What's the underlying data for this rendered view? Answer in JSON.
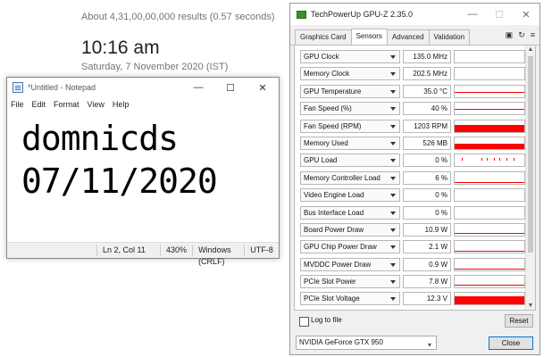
{
  "google": {
    "results": "About 4,31,00,00,000 results (0.57 seconds)",
    "time": "10:16 am",
    "date": "Saturday, 7 November 2020 (IST)"
  },
  "notepad": {
    "title": "*Untitled - Notepad",
    "menu": [
      "File",
      "Edit",
      "Format",
      "View",
      "Help"
    ],
    "lines": [
      "domnicds",
      "07/11/2020"
    ],
    "status": {
      "position": "Ln 2, Col 11",
      "zoom": "430%",
      "eol": "Windows (CRLF)",
      "encoding": "UTF-8"
    },
    "controls": {
      "minimize": "—",
      "maximize": "☐",
      "close": "✕"
    }
  },
  "gpuz": {
    "title": "TechPowerUp GPU-Z 2.35.0",
    "controls": {
      "minimize": "—",
      "maximize": "☐",
      "close": "✕"
    },
    "tabs": [
      "Graphics Card",
      "Sensors",
      "Advanced",
      "Validation"
    ],
    "active_tab": "Sensors",
    "tools": {
      "camera": "▣",
      "refresh": "↻",
      "menu": "≡"
    },
    "sensors": [
      {
        "label": "GPU Clock",
        "value": "135.0 MHz",
        "graph": "none",
        "level": 0
      },
      {
        "label": "Memory Clock",
        "value": "202.5 MHz",
        "graph": "none",
        "level": 0
      },
      {
        "label": "GPU Temperature",
        "value": "35.0 °C",
        "graph": "line",
        "level": 0.35
      },
      {
        "label": "Fan Speed (%)",
        "value": "40 %",
        "graph": "line",
        "level": 0.4
      },
      {
        "label": "Fan Speed (RPM)",
        "value": "1203 RPM",
        "graph": "fill",
        "level": 0.6
      },
      {
        "label": "Memory Used",
        "value": "526 MB",
        "graph": "fill",
        "level": 0.45
      },
      {
        "label": "GPU Load",
        "value": "0 %",
        "graph": "spikes",
        "level": 0
      },
      {
        "label": "Memory Controller Load",
        "value": "6 %",
        "graph": "line",
        "level": 0.1
      },
      {
        "label": "Video Engine Load",
        "value": "0 %",
        "graph": "none",
        "level": 0
      },
      {
        "label": "Bus Interface Load",
        "value": "0 %",
        "graph": "none",
        "level": 0
      },
      {
        "label": "Board Power Draw",
        "value": "10.9 W",
        "graph": "line",
        "level": 0.15
      },
      {
        "label": "GPU Chip Power Draw",
        "value": "2.1 W",
        "graph": "line",
        "level": 0.05
      },
      {
        "label": "MVDDC Power Draw",
        "value": "0.9 W",
        "graph": "line",
        "level": 0.05
      },
      {
        "label": "PCIe Slot Power",
        "value": "7.8 W",
        "graph": "line",
        "level": 0.15
      },
      {
        "label": "PCIe Slot Voltage",
        "value": "12.3 V",
        "graph": "fill",
        "level": 0.7
      }
    ],
    "log_label": "Log to file",
    "reset_label": "Reset",
    "gpu_name": "NVIDIA GeForce GTX 950",
    "close_label": "Close",
    "accent": "#ff0000"
  }
}
